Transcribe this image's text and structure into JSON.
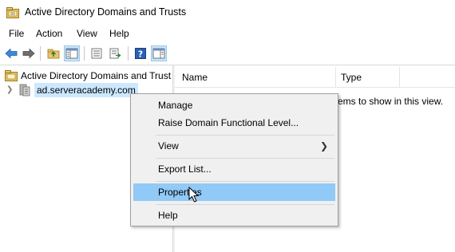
{
  "window": {
    "title": "Active Directory Domains and Trusts",
    "app_icon": "ad-domains-trusts-icon"
  },
  "menubar": {
    "items": [
      "File",
      "Action",
      "View",
      "Help"
    ]
  },
  "toolbar": {
    "buttons": [
      "back-arrow-icon",
      "forward-arrow-icon",
      "up-folder-icon",
      "show-hide-tree-icon",
      "properties-sheet-icon",
      "export-list-icon",
      "help-icon",
      "show-hide-action-pane-icon"
    ]
  },
  "tree": {
    "root_label": "Active Directory Domains and Trust",
    "child_label": "ad.serveracademy.com"
  },
  "list": {
    "columns": [
      "Name",
      "Type"
    ],
    "empty_message": "ems to show in this view."
  },
  "context_menu": {
    "items": {
      "manage": "Manage",
      "raise_level": "Raise Domain Functional Level...",
      "view": "View",
      "export_list": "Export List...",
      "properties": "Properties",
      "help": "Help"
    },
    "highlighted": "Properties"
  },
  "colors": {
    "selection_highlight": "#91c9f7",
    "tree_selection": "#cce8ff",
    "menu_background": "#f0f0f0"
  }
}
